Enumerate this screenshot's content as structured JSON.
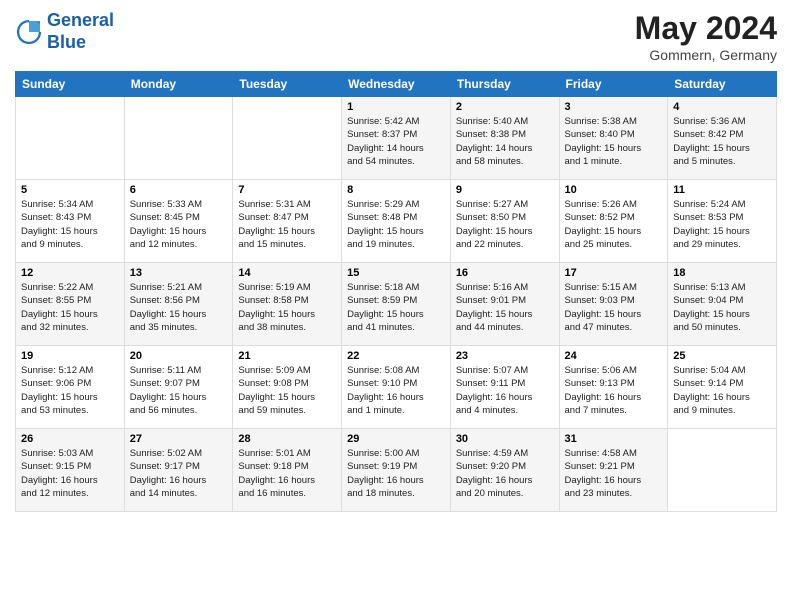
{
  "header": {
    "logo_line1": "General",
    "logo_line2": "Blue",
    "month": "May 2024",
    "location": "Gommern, Germany"
  },
  "days_of_week": [
    "Sunday",
    "Monday",
    "Tuesday",
    "Wednesday",
    "Thursday",
    "Friday",
    "Saturday"
  ],
  "weeks": [
    [
      {
        "day": "",
        "info": ""
      },
      {
        "day": "",
        "info": ""
      },
      {
        "day": "",
        "info": ""
      },
      {
        "day": "1",
        "info": "Sunrise: 5:42 AM\nSunset: 8:37 PM\nDaylight: 14 hours\nand 54 minutes."
      },
      {
        "day": "2",
        "info": "Sunrise: 5:40 AM\nSunset: 8:38 PM\nDaylight: 14 hours\nand 58 minutes."
      },
      {
        "day": "3",
        "info": "Sunrise: 5:38 AM\nSunset: 8:40 PM\nDaylight: 15 hours\nand 1 minute."
      },
      {
        "day": "4",
        "info": "Sunrise: 5:36 AM\nSunset: 8:42 PM\nDaylight: 15 hours\nand 5 minutes."
      }
    ],
    [
      {
        "day": "5",
        "info": "Sunrise: 5:34 AM\nSunset: 8:43 PM\nDaylight: 15 hours\nand 9 minutes."
      },
      {
        "day": "6",
        "info": "Sunrise: 5:33 AM\nSunset: 8:45 PM\nDaylight: 15 hours\nand 12 minutes."
      },
      {
        "day": "7",
        "info": "Sunrise: 5:31 AM\nSunset: 8:47 PM\nDaylight: 15 hours\nand 15 minutes."
      },
      {
        "day": "8",
        "info": "Sunrise: 5:29 AM\nSunset: 8:48 PM\nDaylight: 15 hours\nand 19 minutes."
      },
      {
        "day": "9",
        "info": "Sunrise: 5:27 AM\nSunset: 8:50 PM\nDaylight: 15 hours\nand 22 minutes."
      },
      {
        "day": "10",
        "info": "Sunrise: 5:26 AM\nSunset: 8:52 PM\nDaylight: 15 hours\nand 25 minutes."
      },
      {
        "day": "11",
        "info": "Sunrise: 5:24 AM\nSunset: 8:53 PM\nDaylight: 15 hours\nand 29 minutes."
      }
    ],
    [
      {
        "day": "12",
        "info": "Sunrise: 5:22 AM\nSunset: 8:55 PM\nDaylight: 15 hours\nand 32 minutes."
      },
      {
        "day": "13",
        "info": "Sunrise: 5:21 AM\nSunset: 8:56 PM\nDaylight: 15 hours\nand 35 minutes."
      },
      {
        "day": "14",
        "info": "Sunrise: 5:19 AM\nSunset: 8:58 PM\nDaylight: 15 hours\nand 38 minutes."
      },
      {
        "day": "15",
        "info": "Sunrise: 5:18 AM\nSunset: 8:59 PM\nDaylight: 15 hours\nand 41 minutes."
      },
      {
        "day": "16",
        "info": "Sunrise: 5:16 AM\nSunset: 9:01 PM\nDaylight: 15 hours\nand 44 minutes."
      },
      {
        "day": "17",
        "info": "Sunrise: 5:15 AM\nSunset: 9:03 PM\nDaylight: 15 hours\nand 47 minutes."
      },
      {
        "day": "18",
        "info": "Sunrise: 5:13 AM\nSunset: 9:04 PM\nDaylight: 15 hours\nand 50 minutes."
      }
    ],
    [
      {
        "day": "19",
        "info": "Sunrise: 5:12 AM\nSunset: 9:06 PM\nDaylight: 15 hours\nand 53 minutes."
      },
      {
        "day": "20",
        "info": "Sunrise: 5:11 AM\nSunset: 9:07 PM\nDaylight: 15 hours\nand 56 minutes."
      },
      {
        "day": "21",
        "info": "Sunrise: 5:09 AM\nSunset: 9:08 PM\nDaylight: 15 hours\nand 59 minutes."
      },
      {
        "day": "22",
        "info": "Sunrise: 5:08 AM\nSunset: 9:10 PM\nDaylight: 16 hours\nand 1 minute."
      },
      {
        "day": "23",
        "info": "Sunrise: 5:07 AM\nSunset: 9:11 PM\nDaylight: 16 hours\nand 4 minutes."
      },
      {
        "day": "24",
        "info": "Sunrise: 5:06 AM\nSunset: 9:13 PM\nDaylight: 16 hours\nand 7 minutes."
      },
      {
        "day": "25",
        "info": "Sunrise: 5:04 AM\nSunset: 9:14 PM\nDaylight: 16 hours\nand 9 minutes."
      }
    ],
    [
      {
        "day": "26",
        "info": "Sunrise: 5:03 AM\nSunset: 9:15 PM\nDaylight: 16 hours\nand 12 minutes."
      },
      {
        "day": "27",
        "info": "Sunrise: 5:02 AM\nSunset: 9:17 PM\nDaylight: 16 hours\nand 14 minutes."
      },
      {
        "day": "28",
        "info": "Sunrise: 5:01 AM\nSunset: 9:18 PM\nDaylight: 16 hours\nand 16 minutes."
      },
      {
        "day": "29",
        "info": "Sunrise: 5:00 AM\nSunset: 9:19 PM\nDaylight: 16 hours\nand 18 minutes."
      },
      {
        "day": "30",
        "info": "Sunrise: 4:59 AM\nSunset: 9:20 PM\nDaylight: 16 hours\nand 20 minutes."
      },
      {
        "day": "31",
        "info": "Sunrise: 4:58 AM\nSunset: 9:21 PM\nDaylight: 16 hours\nand 23 minutes."
      },
      {
        "day": "",
        "info": ""
      }
    ]
  ]
}
